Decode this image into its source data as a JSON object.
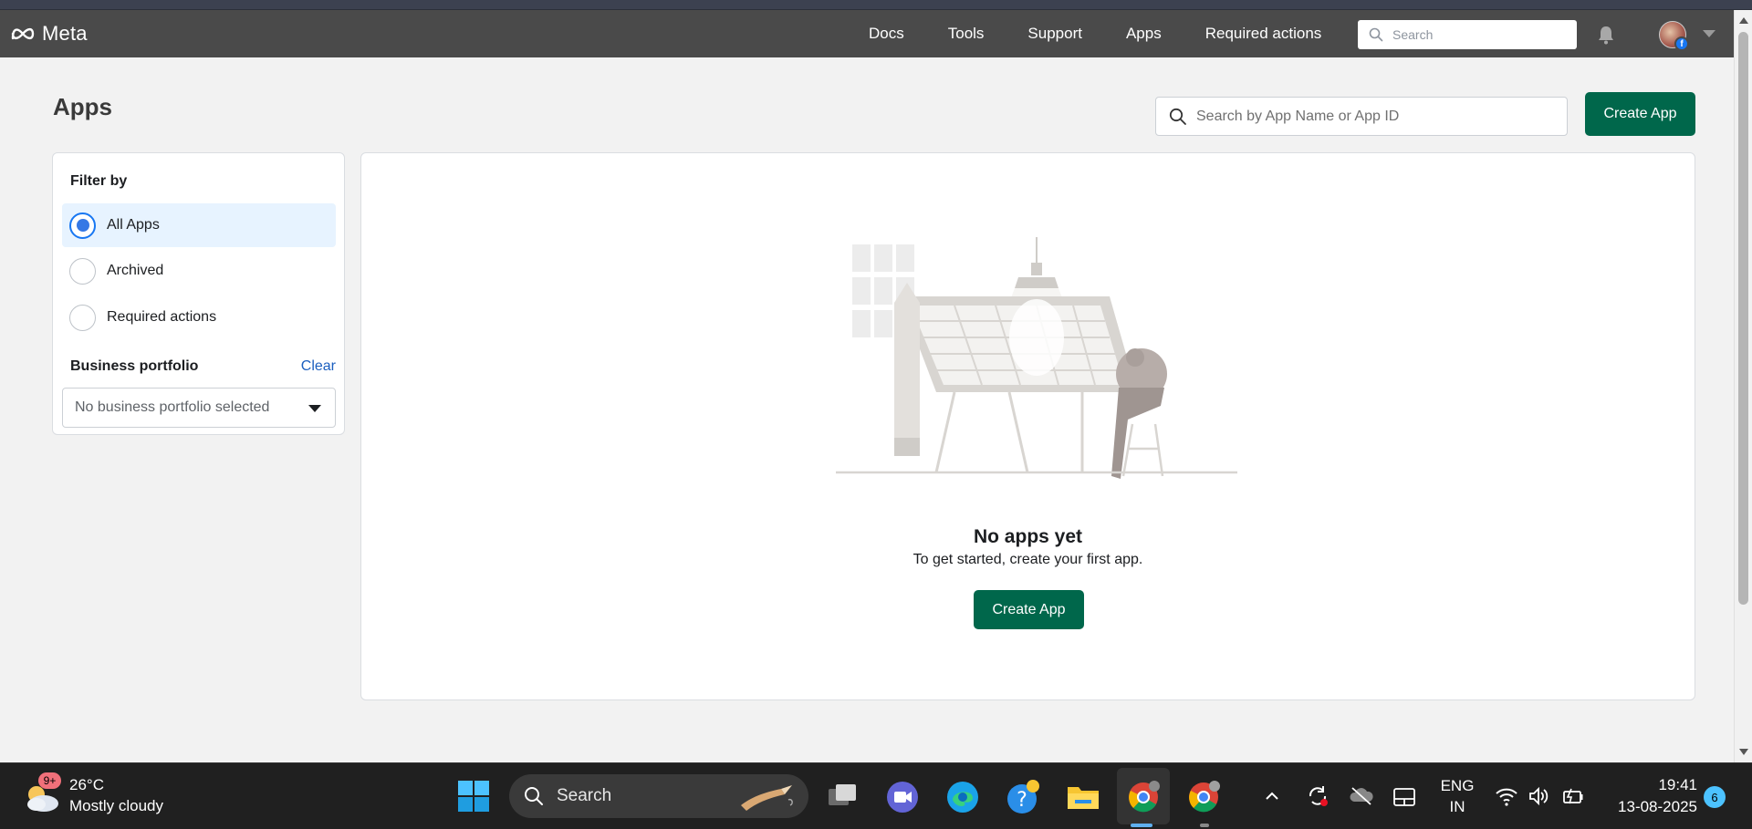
{
  "topnav": {
    "brand": "Meta",
    "links": [
      "Docs",
      "Tools",
      "Support",
      "Apps",
      "Required actions"
    ],
    "search_placeholder": "Search",
    "avatar_badge": "f"
  },
  "page": {
    "title": "Apps",
    "search_placeholder": "Search by App Name or App ID",
    "create_label": "Create App"
  },
  "filter": {
    "title": "Filter by",
    "options": [
      {
        "label": "All Apps",
        "selected": true
      },
      {
        "label": "Archived",
        "selected": false
      },
      {
        "label": "Required actions",
        "selected": false
      }
    ],
    "portfolio_title": "Business portfolio",
    "clear_label": "Clear",
    "portfolio_value": "No business portfolio selected"
  },
  "empty": {
    "title": "No apps yet",
    "subtitle": "To get started, create your first app.",
    "create_label": "Create App"
  },
  "taskbar": {
    "weather_badge": "9+",
    "temperature": "26°C",
    "weather_desc": "Mostly cloudy",
    "search_label": "Search",
    "lang_line1": "ENG",
    "lang_line2": "IN",
    "time": "19:41",
    "date": "13-08-2025",
    "notification_count": "6"
  },
  "colors": {
    "nav_bg": "#4a4a4a",
    "primary_button": "#00674b",
    "link": "#1c5fbf",
    "selected_row": "#e7f3ff"
  }
}
